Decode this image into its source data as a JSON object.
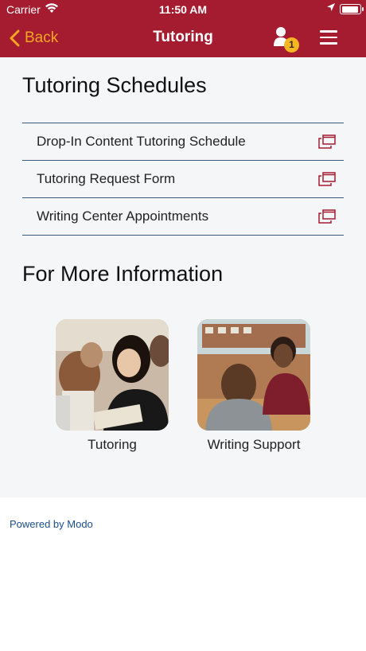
{
  "status_bar": {
    "carrier": "Carrier",
    "time": "11:50 AM"
  },
  "nav": {
    "back_label": "Back",
    "title": "Tutoring",
    "notification_count": "1"
  },
  "schedules": {
    "heading": "Tutoring Schedules",
    "items": [
      {
        "label": "Drop-In Content Tutoring Schedule"
      },
      {
        "label": "Tutoring Request Form"
      },
      {
        "label": "Writing Center Appointments"
      }
    ]
  },
  "more_info": {
    "heading": "For More Information",
    "tiles": [
      {
        "label": "Tutoring"
      },
      {
        "label": "Writing Support"
      }
    ]
  },
  "footer": {
    "powered_by": "Powered by Modo"
  },
  "colors": {
    "header": "#a51c30",
    "accent": "#f5a623",
    "divider": "#3c5a7a",
    "link_icon": "#a51c30"
  }
}
